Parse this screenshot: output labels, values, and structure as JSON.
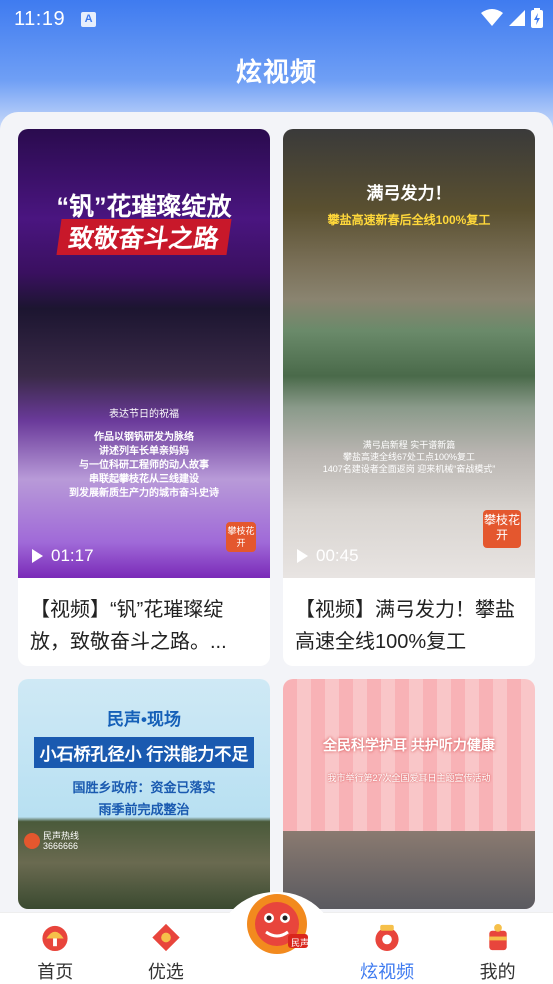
{
  "status": {
    "time": "11:19",
    "a_label": "A"
  },
  "header": {
    "title": "炫视频"
  },
  "cards": [
    {
      "overlay_title_1": "“钒”花璀璨绽放",
      "overlay_title_2": "致敬奋斗之路",
      "overlay_sub": "表达节日的祝福",
      "overlay_lines": [
        "作品以钢钒研发为脉络",
        "讲述列车长单亲妈妈",
        "与一位科研工程师的动人故事",
        "串联起攀枝花从三线建设",
        "到发展新质生产力的城市奋斗史诗"
      ],
      "badge": "攀枝花开",
      "duration": "01:17",
      "caption": "【视频】“钒”花璀璨绽放，致敬奋斗之路。..."
    },
    {
      "overlay_title_1": "满弓发力！",
      "overlay_title_2": "攀盐高速新春后全线100%复工",
      "overlay_lines": [
        "满弓启新程 实干谱新篇",
        "攀盐高速全线67处工点100%复工",
        "1407名建设者全面返岗 迎来机械“奋战模式”"
      ],
      "badge": "攀枝花开",
      "duration": "00:45",
      "caption": "【视频】满弓发力！攀盐高速全线100%复工"
    },
    {
      "overlay_title_1": "民声•现场",
      "overlay_title_2": "小石桥孔径小 行洪能力不足",
      "overlay_lines": [
        "国胜乡政府：资金已落实",
        "雨季前完成整治"
      ],
      "hotline": "民声热线",
      "hotline_num": "3666666"
    },
    {
      "overlay_title_1": "全民科学护耳 共护听力健康",
      "overlay_lines": [
        "我市举行第27次全国爱耳日主题宣传活动"
      ]
    }
  ],
  "tabbar": {
    "items": [
      {
        "label": "首页",
        "icon": "home-icon"
      },
      {
        "label": "优选",
        "icon": "selected-icon"
      },
      {
        "label": "炫视频",
        "icon": "video-icon"
      },
      {
        "label": "我的",
        "icon": "profile-icon"
      }
    ],
    "mascot_label": "民声"
  },
  "colors": {
    "accent": "#3f7bf0",
    "badge": "#e4572e"
  }
}
